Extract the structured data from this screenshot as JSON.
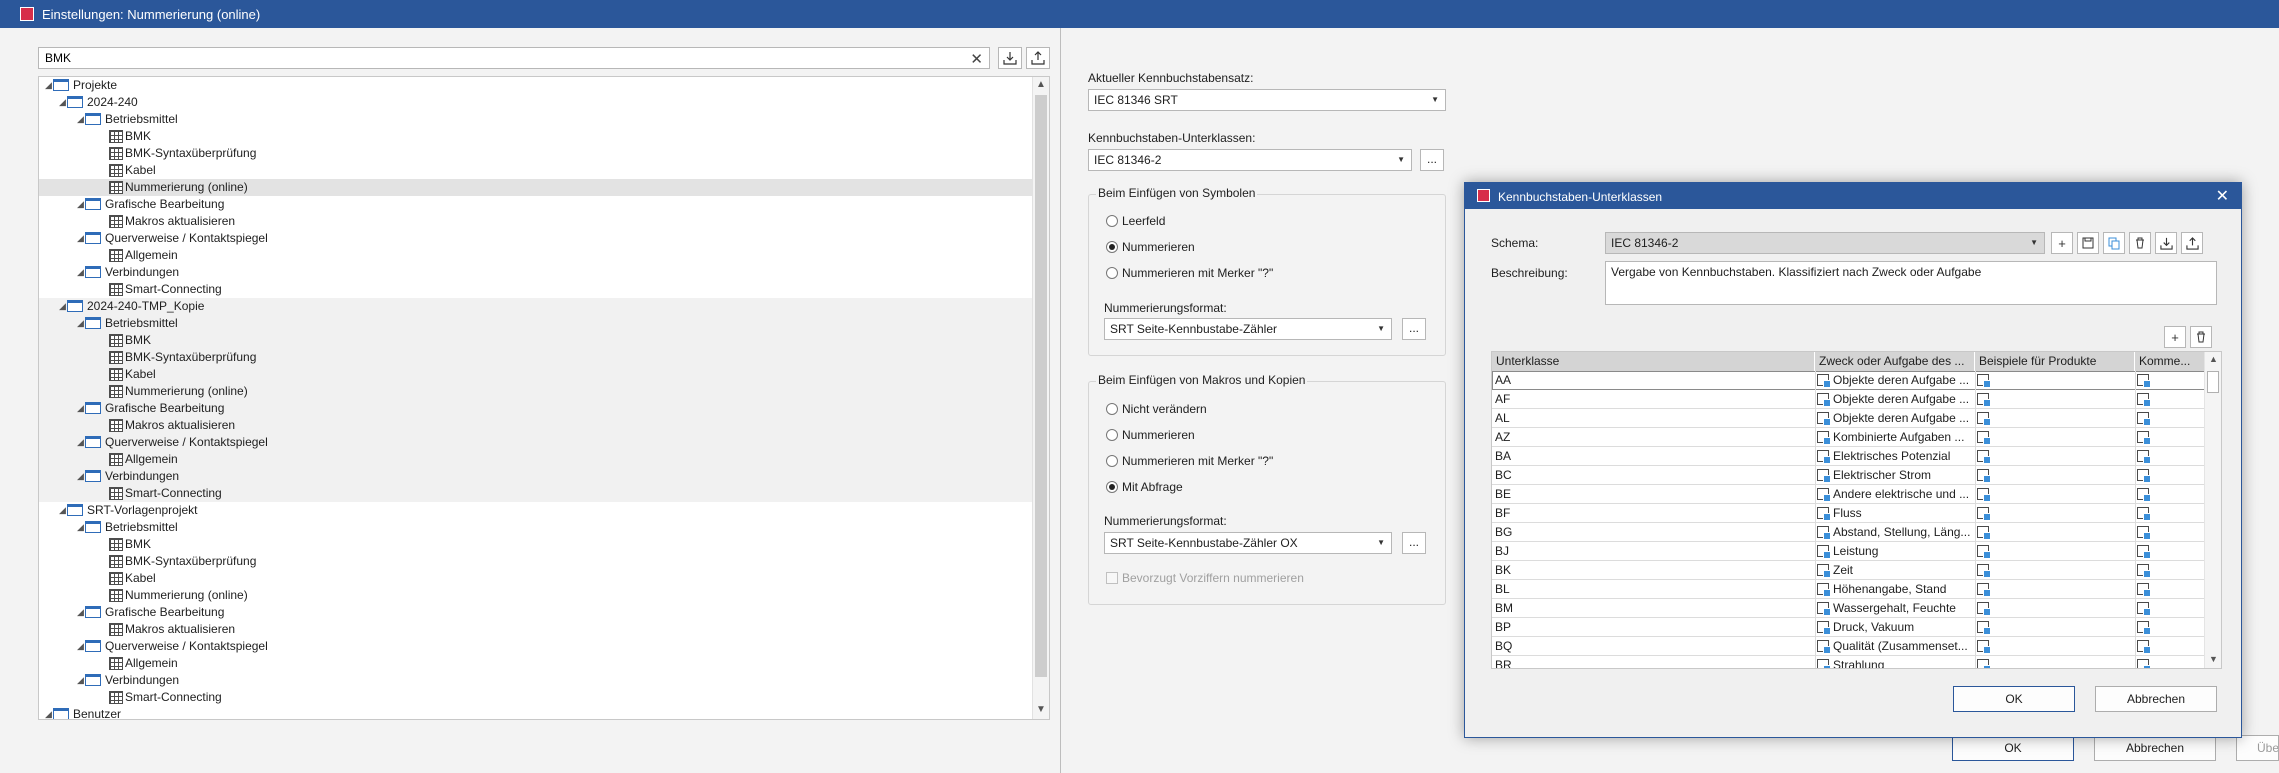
{
  "window": {
    "title": "Einstellungen: Nummerierung (online)"
  },
  "search": {
    "value": "BMK"
  },
  "tree": [
    {
      "label": "Projekte",
      "level": 0,
      "icon": "folder",
      "arrow": true,
      "style": ""
    },
    {
      "label": "2024-240",
      "level": 1,
      "icon": "folder",
      "arrow": true,
      "style": ""
    },
    {
      "label": "Betriebsmittel",
      "level": 2,
      "icon": "folder",
      "arrow": true,
      "style": ""
    },
    {
      "label": "BMK",
      "level": 3,
      "icon": "table",
      "arrow": false,
      "style": ""
    },
    {
      "label": "BMK-Syntaxüberprüfung",
      "level": 3,
      "icon": "table",
      "arrow": false,
      "style": ""
    },
    {
      "label": "Kabel",
      "level": 3,
      "icon": "table",
      "arrow": false,
      "style": ""
    },
    {
      "label": "Nummerierung (online)",
      "level": 3,
      "icon": "table",
      "arrow": false,
      "style": "sel"
    },
    {
      "label": "Grafische Bearbeitung",
      "level": 2,
      "icon": "folder",
      "arrow": true,
      "style": ""
    },
    {
      "label": "Makros aktualisieren",
      "level": 3,
      "icon": "table",
      "arrow": false,
      "style": ""
    },
    {
      "label": "Querverweise / Kontaktspiegel",
      "level": 2,
      "icon": "folder",
      "arrow": true,
      "style": ""
    },
    {
      "label": "Allgemein",
      "level": 3,
      "icon": "table",
      "arrow": false,
      "style": ""
    },
    {
      "label": "Verbindungen",
      "level": 2,
      "icon": "folder",
      "arrow": true,
      "style": ""
    },
    {
      "label": "Smart-Connecting",
      "level": 3,
      "icon": "table",
      "arrow": false,
      "style": ""
    },
    {
      "label": "2024-240-TMP_Kopie",
      "level": 1,
      "icon": "folder",
      "arrow": true,
      "style": "gray"
    },
    {
      "label": "Betriebsmittel",
      "level": 2,
      "icon": "folder",
      "arrow": true,
      "style": "gray"
    },
    {
      "label": "BMK",
      "level": 3,
      "icon": "table",
      "arrow": false,
      "style": "gray"
    },
    {
      "label": "BMK-Syntaxüberprüfung",
      "level": 3,
      "icon": "table",
      "arrow": false,
      "style": "gray"
    },
    {
      "label": "Kabel",
      "level": 3,
      "icon": "table",
      "arrow": false,
      "style": "gray"
    },
    {
      "label": "Nummerierung (online)",
      "level": 3,
      "icon": "table",
      "arrow": false,
      "style": "gray"
    },
    {
      "label": "Grafische Bearbeitung",
      "level": 2,
      "icon": "folder",
      "arrow": true,
      "style": "gray"
    },
    {
      "label": "Makros aktualisieren",
      "level": 3,
      "icon": "table",
      "arrow": false,
      "style": "gray"
    },
    {
      "label": "Querverweise / Kontaktspiegel",
      "level": 2,
      "icon": "folder",
      "arrow": true,
      "style": "gray"
    },
    {
      "label": "Allgemein",
      "level": 3,
      "icon": "table",
      "arrow": false,
      "style": "gray"
    },
    {
      "label": "Verbindungen",
      "level": 2,
      "icon": "folder",
      "arrow": true,
      "style": "gray"
    },
    {
      "label": "Smart-Connecting",
      "level": 3,
      "icon": "table",
      "arrow": false,
      "style": "gray"
    },
    {
      "label": "SRT-Vorlagenprojekt",
      "level": 1,
      "icon": "folder",
      "arrow": true,
      "style": ""
    },
    {
      "label": "Betriebsmittel",
      "level": 2,
      "icon": "folder",
      "arrow": true,
      "style": ""
    },
    {
      "label": "BMK",
      "level": 3,
      "icon": "table",
      "arrow": false,
      "style": ""
    },
    {
      "label": "BMK-Syntaxüberprüfung",
      "level": 3,
      "icon": "table",
      "arrow": false,
      "style": ""
    },
    {
      "label": "Kabel",
      "level": 3,
      "icon": "table",
      "arrow": false,
      "style": ""
    },
    {
      "label": "Nummerierung (online)",
      "level": 3,
      "icon": "table",
      "arrow": false,
      "style": ""
    },
    {
      "label": "Grafische Bearbeitung",
      "level": 2,
      "icon": "folder",
      "arrow": true,
      "style": ""
    },
    {
      "label": "Makros aktualisieren",
      "level": 3,
      "icon": "table",
      "arrow": false,
      "style": ""
    },
    {
      "label": "Querverweise / Kontaktspiegel",
      "level": 2,
      "icon": "folder",
      "arrow": true,
      "style": ""
    },
    {
      "label": "Allgemein",
      "level": 3,
      "icon": "table",
      "arrow": false,
      "style": ""
    },
    {
      "label": "Verbindungen",
      "level": 2,
      "icon": "folder",
      "arrow": true,
      "style": ""
    },
    {
      "label": "Smart-Connecting",
      "level": 3,
      "icon": "table",
      "arrow": false,
      "style": ""
    },
    {
      "label": "Benutzer",
      "level": 0,
      "icon": "folder",
      "arrow": true,
      "style": ""
    }
  ],
  "settings": {
    "set_label": "Aktueller Kennbuchstabensatz:",
    "set_value": "IEC 81346 SRT",
    "sub_label": "Kennbuchstaben-Unterklassen:",
    "sub_value": "IEC 81346-2",
    "dots": "...",
    "group1": {
      "title": "Beim Einfügen von Symbolen",
      "options": [
        "Leerfeld",
        "Nummerieren",
        "Nummerieren mit Merker \"?\""
      ],
      "selected": 1,
      "format_label": "Nummerierungsformat:",
      "format_value": "SRT Seite-Kennbustabe-Zähler"
    },
    "group2": {
      "title": "Beim Einfügen von Makros und Kopien",
      "options": [
        "Nicht verändern",
        "Nummerieren",
        "Nummerieren mit Merker \"?\"",
        "Mit Abfrage"
      ],
      "selected": 3,
      "format_label": "Nummerierungsformat:",
      "format_value": "SRT Seite-Kennbustabe-Zähler OX",
      "checkbox": "Bevorzugt Vorziffern nummerieren"
    }
  },
  "main_buttons": {
    "ok": "OK",
    "cancel": "Abbrechen",
    "apply": "Übe"
  },
  "dialog": {
    "title": "Kennbuchstaben-Unterklassen",
    "schema_label": "Schema:",
    "schema_value": "IEC 81346-2",
    "desc_label": "Beschreibung:",
    "desc_value": "Vergabe von Kennbuchstaben. Klassifiziert nach Zweck oder Aufgabe",
    "columns": [
      "Unterklasse",
      "Zweck oder Aufgabe des ...",
      "Beispiele für Produkte",
      "Komme..."
    ],
    "rows": [
      [
        "AA",
        "Objekte deren Aufgabe ..."
      ],
      [
        "AF",
        "Objekte deren Aufgabe ..."
      ],
      [
        "AL",
        "Objekte deren Aufgabe ..."
      ],
      [
        "AZ",
        "Kombinierte Aufgaben ..."
      ],
      [
        "BA",
        "Elektrisches Potenzial"
      ],
      [
        "BC",
        "Elektrischer Strom"
      ],
      [
        "BE",
        "Andere elektrische und ..."
      ],
      [
        "BF",
        "Fluss"
      ],
      [
        "BG",
        "Abstand, Stellung, Läng..."
      ],
      [
        "BJ",
        "Leistung"
      ],
      [
        "BK",
        "Zeit"
      ],
      [
        "BL",
        "Höhenangabe, Stand"
      ],
      [
        "BM",
        "Wassergehalt, Feuchte"
      ],
      [
        "BP",
        "Druck, Vakuum"
      ],
      [
        "BQ",
        "Qualität (Zusammenset..."
      ],
      [
        "BR",
        "Strahlung"
      ]
    ],
    "ok": "OK",
    "cancel": "Abbrechen"
  }
}
